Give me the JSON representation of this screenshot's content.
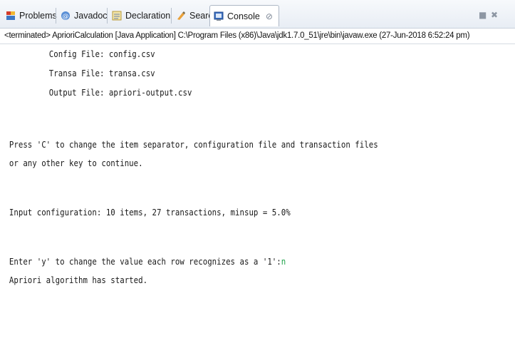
{
  "tabs": [
    {
      "label": "Problems",
      "icon": "problems-icon"
    },
    {
      "label": "Javadoc",
      "icon": "javadoc-icon"
    },
    {
      "label": "Declaration",
      "icon": "declaration-icon"
    },
    {
      "label": "Search",
      "icon": "search-icon"
    },
    {
      "label": "Console",
      "icon": "console-icon",
      "active": true,
      "close": "⊘"
    }
  ],
  "window_controls": {
    "minimize": "■",
    "close": "✖"
  },
  "status": "<terminated> AprioriCalculation [Java Application] C:\\Program Files (x86)\\Java\\jdk1.7.0_51\\jre\\bin\\javaw.exe (27-Jun-2018 6:52:24 pm)",
  "console": {
    "config_file": "Config File: config.csv",
    "transa_file": "Transa File: transa.csv",
    "output_file": "Output File: apriori-output.csv",
    "press_c": "Press 'C' to change the item separator, configuration file and transaction files",
    "any_key": "or any other key to continue.",
    "input_config": "Input configuration: 10 items, 27 transactions, minsup = 5.0%",
    "enter_y": "Enter 'y' to change the value each row recognizes as a '1':",
    "user_input": "n",
    "started": "Apriori algorithm has started."
  },
  "colors": {
    "input_text": "#1fa34a",
    "tab_border": "#aeb8c6"
  }
}
